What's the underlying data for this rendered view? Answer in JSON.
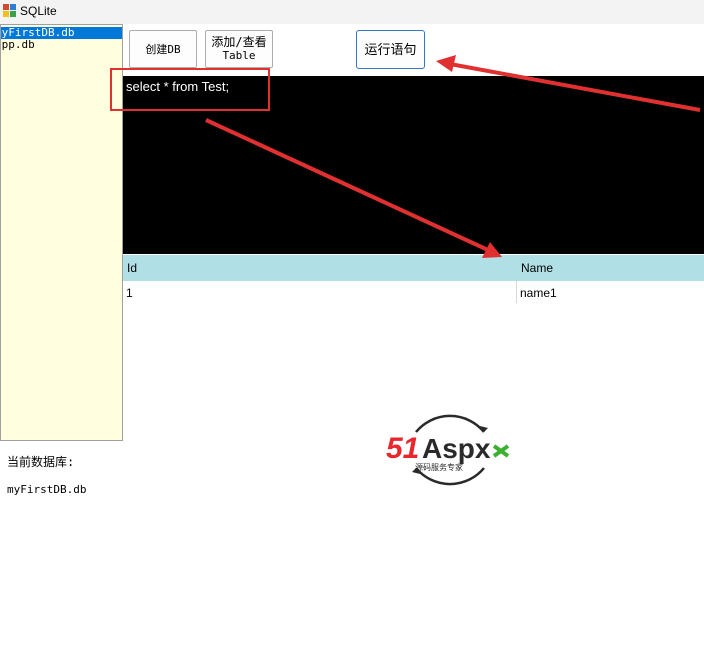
{
  "window": {
    "title": "SQLite"
  },
  "sidebar": {
    "databases": [
      {
        "name": "myFirstDB.db",
        "selected": true
      },
      {
        "name": "app.db",
        "selected": false
      }
    ],
    "current_db_label": "当前数据库:",
    "current_db_value": "myFirstDB.db"
  },
  "toolbar": {
    "create_db_label": "创建DB",
    "add_table_label_line1": "添加/查看",
    "add_table_label_line2": "Table",
    "run_label": "运行语句"
  },
  "editor": {
    "sql": "select * from Test;"
  },
  "result_grid": {
    "columns": [
      "Id",
      "Name"
    ],
    "rows": [
      [
        "1",
        "name1"
      ]
    ]
  },
  "watermark": {
    "brand_number": "51",
    "brand_text": "Aspx",
    "tagline": "源码服务专家"
  },
  "colors": {
    "editor_bg": "#000000",
    "grid_header_bg": "#b0dfe6",
    "sidebar_bg": "#ffffe0",
    "selection": "#0078d7",
    "annotation": "#e03030",
    "logo_red": "#e8262b",
    "logo_green": "#3cb032"
  }
}
